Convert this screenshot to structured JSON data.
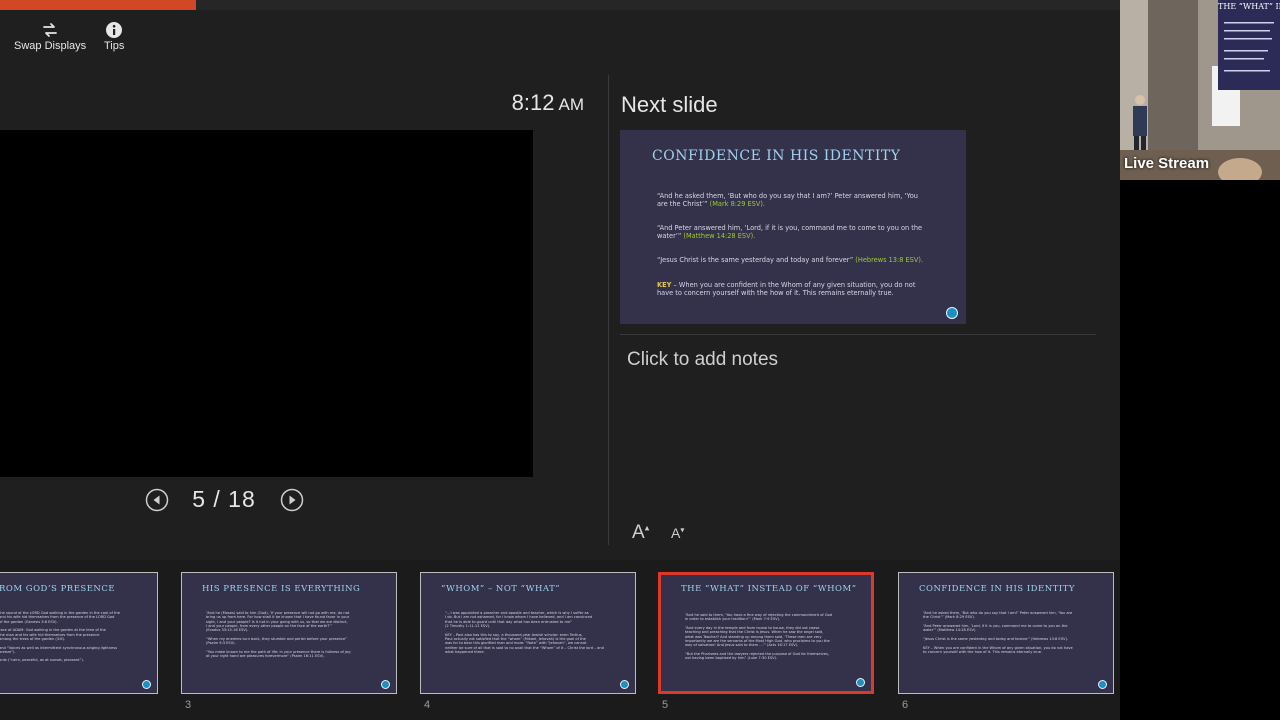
{
  "toolbar": {
    "swap_displays": "Swap Displays",
    "tips": "Tips"
  },
  "clock": {
    "time": "8:12",
    "ampm": "AM"
  },
  "navigation": {
    "counter": "5 / 18"
  },
  "next_slide": {
    "label": "Next slide",
    "title": "CONFIDENCE IN HIS IDENTITY",
    "items": [
      {
        "text": "“And he asked them, ‘But who do you say that I am?’ Peter answered him, ‘You are the Christ’”",
        "ref": "(Mark 8:29 ESV)."
      },
      {
        "text": "“And Peter answered him, ‘Lord, if it is you, command me to come to you on the water’”",
        "ref": "(Matthew 14:28 ESV)."
      },
      {
        "text": "“Jesus Christ is the same yesterday and today and forever”",
        "ref": "(Hebrews 13:8 ESV)."
      }
    ],
    "key_label": "KEY",
    "key_text": "– When you are confident in the Whom of any given situation, you do not have to concern yourself with the how of it. This remains eternally true."
  },
  "notes": {
    "placeholder": "Click to add notes"
  },
  "webcam": {
    "label": "Live Stream",
    "screen_title": "THE “WHAT” IN"
  },
  "thumbnails": [
    {
      "number": "",
      "title": "ROM GOD’S PRESENCE",
      "lines": [
        "the sound of the LORD God walking in the garden in the cool of the",
        "and his wife hid themselves from the presence of the LORD God",
        "of the garden (Genesis 3:8 ESV).",
        "",
        "race of ADAM: God walking in the garden at the time of the",
        "the man and his wife hid themselves from the presence",
        "among the trees of the garden (3:8).",
        "",
        "and “Voices as well as intermittent synchronous singing lightness",
        "breeze”).",
        "",
        "ords (“calm, peaceful, as at sunset, pleasant”)."
      ],
      "active": false
    },
    {
      "number": "3",
      "title": "HIS PRESENCE IS EVERYTHING",
      "lines": [
        "“And he (Moses) said to him (God), ‘If your presence will not go with me, do not",
        "bring us up from here. For how shall it be known that I have found favor in your",
        "sight, I and your people? Is it not in your going with us, so that we are distinct,",
        "I and your people, from every other people on the face of the earth?’”",
        "(Exodus 33:15-16 ESV).",
        "",
        "“When my enemies turn back, they stumble and perish before your presence”",
        "(Psalm 9:3 ESV).",
        "",
        "“You make known to me the path of life; in your presence there is fullness of joy;",
        "at your right hand are pleasures forevermore” (Psalm 16:11 ESV)."
      ],
      "active": false
    },
    {
      "number": "4",
      "title": "“WHOM” – NOT “WHAT”",
      "lines": [
        "“…I was appointed a preacher and apostle and teacher, which is why I suffer as",
        "I do. But I am not ashamed, for I know whom I have believed, and I am convinced",
        "that he is able to guard until that day what has been entrusted to me”",
        "(2 Timothy 1:11-12 ESV).",
        "",
        "KEY – Paul also has this to say, a thousand-year Jewish scholar: even Tertius,",
        "Paul actually not satisfied that the “whom” (Mikael, Jehovah) is the goal of the",
        "was for to bear this glorified man and more: “Note” with “Jehovah”, we cannot",
        "neither be sure of all that is said to no avail that the “Whom” of it – Christ the lord – and",
        "what happened there."
      ],
      "active": false
    },
    {
      "number": "5",
      "title": "THE “WHAT” INSTEAD OF “WHOM”",
      "lines": [
        "“And he said to them, ‘You have a fine way of rejecting the commandment of God",
        "in order to establish your tradition!’” (Mark 7:9 ESV).",
        "",
        "“And every day in the temple and from house to house, they did not cease",
        "teaching and preaching that the Christ is Jesus. When he saw the angel said,",
        "what was Teacher? And standing up among them said, ‘These men are very",
        "importantly we are the servants of the Most High God, who proclaims to you the",
        "way of salvation! And Jesus said to them …’” (Acts 16:17 ESV).",
        "",
        "“But the Pharisees and the lawyers rejected the purpose of God for themselves,",
        "not having been baptized by him” (Luke 7:30 ESV)."
      ],
      "active": true
    },
    {
      "number": "6",
      "title": "CONFIDENCE IN HIS IDENTITY",
      "lines": [
        "“And he asked them, ‘But who do you say that I am?’ Peter answered him, ‘You are",
        "the Christ’” (Mark 8:29 ESV).",
        "",
        "“And Peter answered him, ‘Lord, if it is you, command me to come to you on the",
        "water’” (Matthew 14:28 ESV).",
        "",
        "“Jesus Christ is the same yesterday and today and forever” (Hebrews 13:8 ESV).",
        "",
        "KEY – When you are confident in the Whom of any given situation, you do not have",
        "to concern yourself with the how of it. This remains eternally true."
      ],
      "active": false
    }
  ],
  "colors": {
    "accent_progress": "#d24726",
    "active_border": "#e0372b",
    "slide_bg": "#34314a",
    "slide_title": "#9ed2ee",
    "reference_green": "#9acd32",
    "key_yellow": "#e8c84a"
  }
}
